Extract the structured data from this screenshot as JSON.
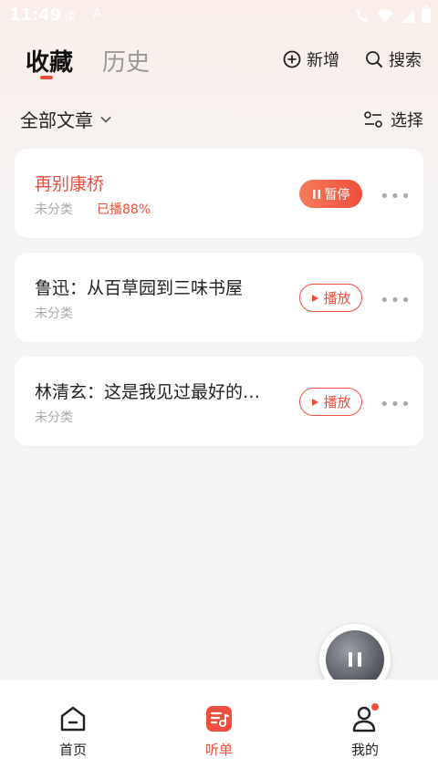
{
  "status_bar": {
    "time": "11:49",
    "icon1": "读",
    "icon2": "A"
  },
  "header": {
    "tabs": [
      {
        "label": "收藏",
        "active": true
      },
      {
        "label": "历史",
        "active": false
      }
    ],
    "add_label": "新增",
    "search_label": "搜索"
  },
  "filter": {
    "label": "全部文章",
    "select_label": "选择"
  },
  "cards": [
    {
      "title": "再别康桥",
      "category": "未分类",
      "progress": "已播88%",
      "button": "暂停",
      "state": "playing"
    },
    {
      "title": "鲁迅：从百草园到三味书屋",
      "category": "未分类",
      "button": "播放",
      "state": "idle"
    },
    {
      "title": "林清玄：这是我见过最好的…",
      "category": "未分类",
      "button": "播放",
      "state": "idle"
    }
  ],
  "more_glyph": "•••",
  "bottom_nav": [
    {
      "label": "首页",
      "icon": "home-icon",
      "active": false
    },
    {
      "label": "听单",
      "icon": "playlist-icon",
      "active": true
    },
    {
      "label": "我的",
      "icon": "profile-icon",
      "active": false
    }
  ],
  "colors": {
    "accent": "#f04e3c",
    "text": "#222222",
    "muted": "#aaaaaa"
  }
}
